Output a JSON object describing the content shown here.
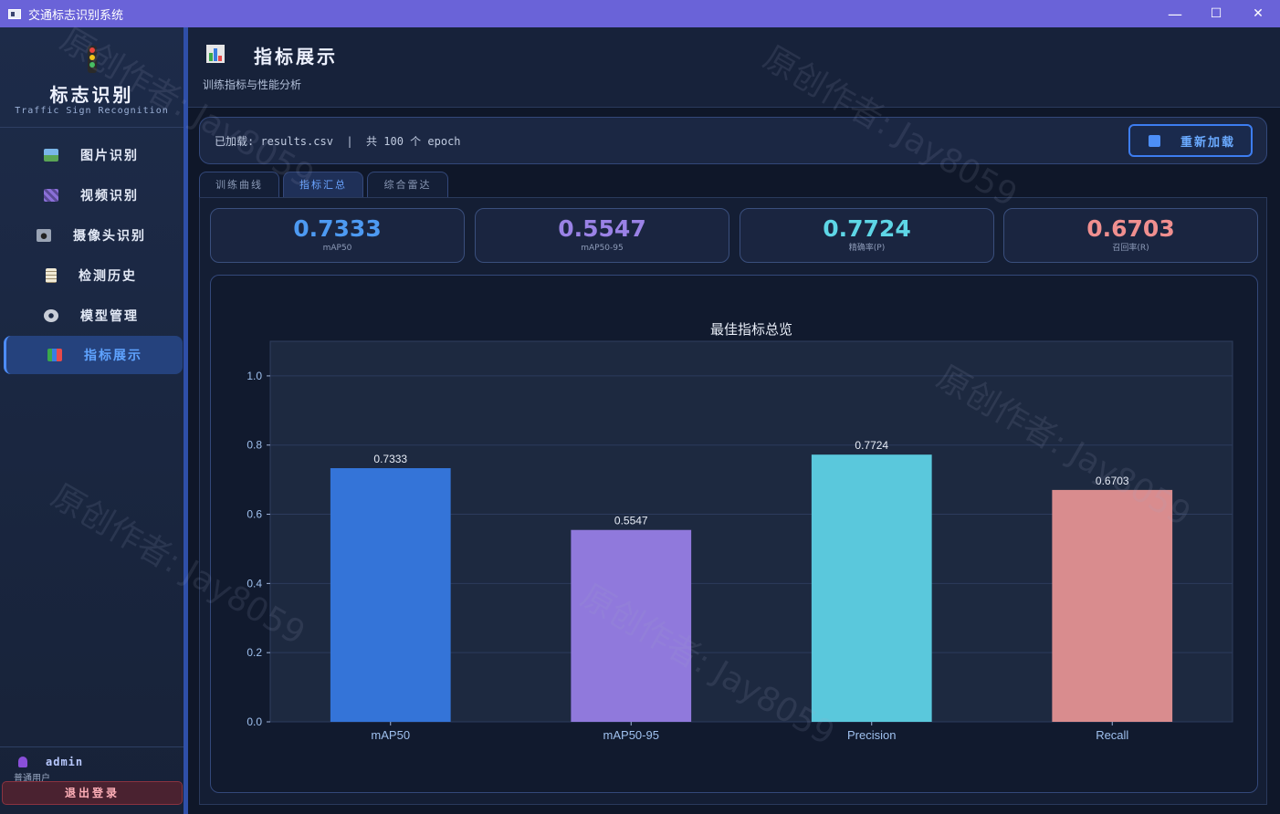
{
  "window": {
    "title": "交通标志识别系统",
    "minimize": "—",
    "maximize": "☐",
    "close": "✕"
  },
  "sidebar": {
    "logo_title": "标志识别",
    "logo_subtitle": "Traffic Sign Recognition",
    "items": [
      {
        "label": "图片识别",
        "icon": "image-icon",
        "color": "#6fb36a"
      },
      {
        "label": "视频识别",
        "icon": "clapper-icon",
        "color": "#8a6fd8"
      },
      {
        "label": "摄像头识别",
        "icon": "camera-icon",
        "color": "#9aa4b5"
      },
      {
        "label": "检测历史",
        "icon": "clipboard-icon",
        "color": "#d8cfb8"
      },
      {
        "label": "模型管理",
        "icon": "gear-icon",
        "color": "#c9ced8"
      },
      {
        "label": "指标展示",
        "icon": "bar-chart-icon",
        "color": "#e6e6e6"
      }
    ],
    "active_index": 5,
    "user": {
      "name": "admin",
      "role": "普通用户"
    },
    "logout_label": "退出登录"
  },
  "header": {
    "title": "指标展示",
    "subtitle": "训练指标与性能分析"
  },
  "infobar": {
    "text": "已加载: results.csv  |  共 100 个 epoch",
    "reload_label": "重新加载"
  },
  "tabs": [
    "训练曲线",
    "指标汇总",
    "综合雷达"
  ],
  "active_tab": 1,
  "metric_cards": [
    {
      "value": "0.7333",
      "label": "mAP50",
      "color": "#4d9af2"
    },
    {
      "value": "0.5547",
      "label": "mAP50-95",
      "color": "#9a82e6"
    },
    {
      "value": "0.7724",
      "label": "精确率(P)",
      "color": "#5ed6e6"
    },
    {
      "value": "0.6703",
      "label": "召回率(R)",
      "color": "#f08f8f"
    }
  ],
  "chart_data": {
    "type": "bar",
    "title": "最佳指标总览",
    "categories": [
      "mAP50",
      "mAP50-95",
      "Precision",
      "Recall"
    ],
    "values": [
      0.7333,
      0.5547,
      0.7724,
      0.6703
    ],
    "value_labels": [
      "0.7333",
      "0.5547",
      "0.7724",
      "0.6703"
    ],
    "colors": [
      "#3474d8",
      "#9079dc",
      "#5ac8dc",
      "#d98c8e"
    ],
    "ylim": [
      0,
      1.1
    ],
    "yticks": [
      0.0,
      0.2,
      0.4,
      0.6,
      0.8,
      1.0
    ],
    "ytick_labels": [
      "0.0",
      "0.2",
      "0.4",
      "0.6",
      "0.8",
      "1.0"
    ],
    "grid": true,
    "xlabel": "",
    "ylabel": ""
  },
  "watermark": "原创作者: Jay8059"
}
